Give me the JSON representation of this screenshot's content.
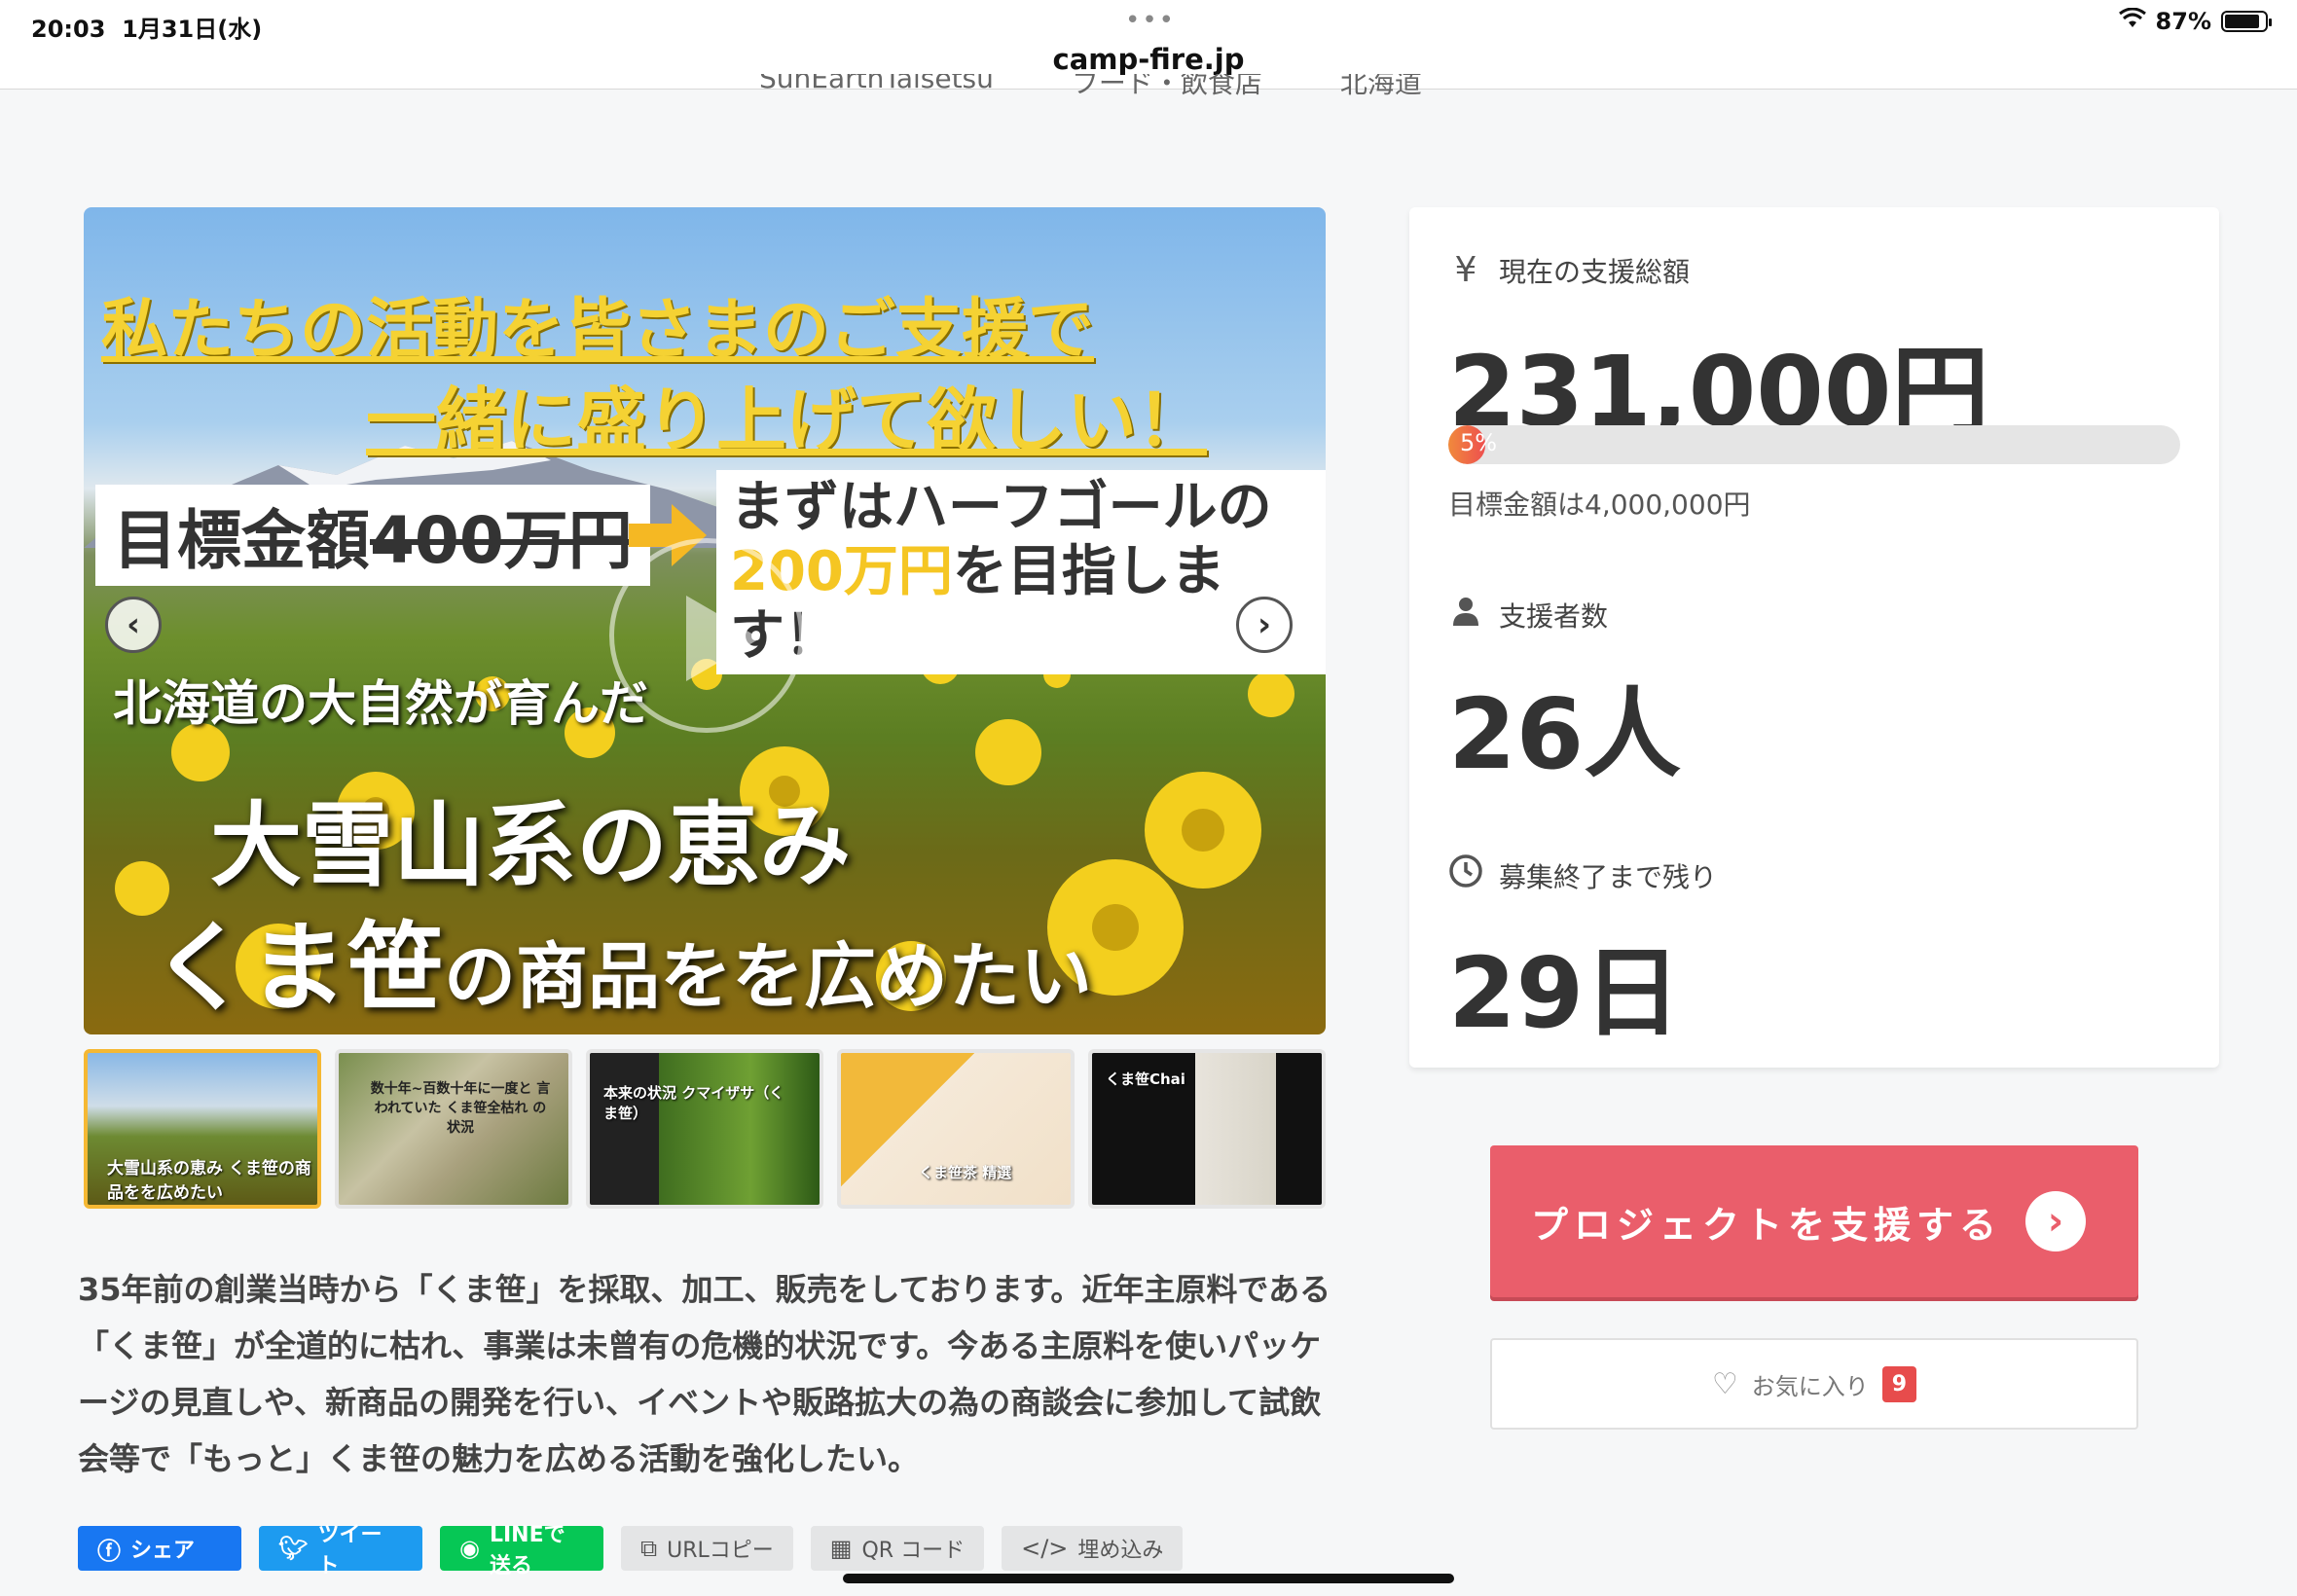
{
  "status_bar": {
    "time": "20:03",
    "date": "1月31日(水)",
    "battery": "87%",
    "battery_level": 0.87
  },
  "browser": {
    "url": "camp-fire.jp"
  },
  "meta": {
    "owner": "SunEarthTaisetsu",
    "category": "フード・飲食店",
    "location": "北海道"
  },
  "hero": {
    "line1": "私たちの活動を皆さまのご支援で",
    "line2": "一緒に盛り上げて欲しい！",
    "goal_prefix": "目標金額",
    "goal_strike": "400万円",
    "half_line1": "まずはハーフゴールの",
    "half_yellow": "200万円",
    "half_line2": "を目指します！",
    "sub": "北海道の大自然が育んだ",
    "big1": "大雪山系の恵み",
    "big2a": "くま笹",
    "big2b": "の商品をを広めたい",
    "prev": "‹",
    "next": "›"
  },
  "thumbnails": [
    {
      "caption": "大雪山系の恵み くま笹の商品をを広めたい"
    },
    {
      "caption": "数十年~百数十年に一度と 言われていた くま笹全枯れ の状況"
    },
    {
      "caption": "本来の状況 クマイザサ（くま笹）"
    },
    {
      "caption": "くま笹茶 精選"
    },
    {
      "caption": "くま笹Chai"
    }
  ],
  "description": "35年前の創業当時から「くま笹」を採取、加工、販売をしております。近年主原料である「くま笹」が全道的に枯れ、事業は未曾有の危機的状況です。今ある主原料を使いパッケージの見直しや、新商品の開発を行い、イベントや販路拡大の為の商談会に参加して試飲会等で「もっと」くま笹の魅力を広める活動を強化したい。",
  "share": {
    "facebook": "シェア",
    "twitter": "ツイート",
    "line": "LINEで送る",
    "url_copy": "URLコピー",
    "qr": "QR コード",
    "embed": "埋め込み"
  },
  "stats": {
    "amount_label": "現在の支援総額",
    "amount": "231,000円",
    "progress_percent": 5,
    "progress_label": "5%",
    "goal": "目標金額は4,000,000円",
    "backers_label": "支援者数",
    "backers": "26人",
    "remaining_label": "募集終了まで残り",
    "remaining": "29日"
  },
  "actions": {
    "support": "プロジェクトを支援する",
    "favorite": "お気に入り",
    "favorite_count": "9"
  },
  "colors": {
    "support_button": "#ea5e6b",
    "progress": "#ee4f4f",
    "favorite_badge": "#e74c4c",
    "facebook": "#1877f2",
    "twitter": "#1d9bf0",
    "line": "#06c755"
  }
}
